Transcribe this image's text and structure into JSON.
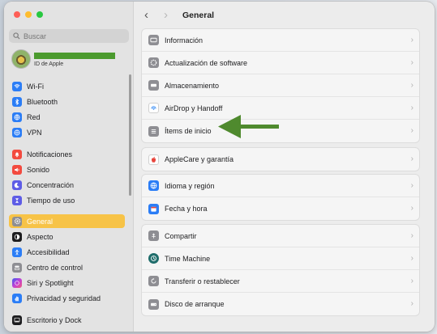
{
  "search": {
    "placeholder": "Buscar"
  },
  "account": {
    "subtitle": "ID de Apple"
  },
  "sidebar": {
    "items": [
      {
        "label": "Wi-Fi",
        "icon": "wifi-icon",
        "color": "#2b7df6"
      },
      {
        "label": "Bluetooth",
        "icon": "bluetooth-icon",
        "color": "#2b7df6"
      },
      {
        "label": "Red",
        "icon": "globe-icon",
        "color": "#2b7df6"
      },
      {
        "label": "VPN",
        "icon": "vpn-globe-icon",
        "color": "#2b7df6"
      },
      {
        "label": "Notificaciones",
        "icon": "bell-icon",
        "color": "#f34a3f"
      },
      {
        "label": "Sonido",
        "icon": "speaker-icon",
        "color": "#f34a3f"
      },
      {
        "label": "Concentración",
        "icon": "moon-icon",
        "color": "#5e5ce6"
      },
      {
        "label": "Tiempo de uso",
        "icon": "hourglass-icon",
        "color": "#5e5ce6"
      },
      {
        "label": "General",
        "icon": "gear-icon",
        "color": "#8e8e93"
      },
      {
        "label": "Aspecto",
        "icon": "appearance-icon",
        "color": "#1c1c1e"
      },
      {
        "label": "Accesibilidad",
        "icon": "accessibility-icon",
        "color": "#2b7df6"
      },
      {
        "label": "Centro de control",
        "icon": "control-center-icon",
        "color": "#8e8e93"
      },
      {
        "label": "Siri y Spotlight",
        "icon": "siri-icon",
        "color": "#b34ad8"
      },
      {
        "label": "Privacidad y seguridad",
        "icon": "hand-icon",
        "color": "#2b7df6"
      },
      {
        "label": "Escritorio y Dock",
        "icon": "dock-icon",
        "color": "#1c1c1e"
      }
    ]
  },
  "header": {
    "title": "General",
    "back": "‹",
    "forward": "›"
  },
  "groups": [
    {
      "rows": [
        {
          "label": "Información",
          "icon": "info-icon",
          "color": "#8e8e93"
        },
        {
          "label": "Actualización de software",
          "icon": "software-update-icon",
          "color": "#8e8e93"
        },
        {
          "label": "Almacenamiento",
          "icon": "storage-icon",
          "color": "#8e8e93"
        },
        {
          "label": "AirDrop y Handoff",
          "icon": "airdrop-icon",
          "color": "#3a8ef5"
        },
        {
          "label": "Ítems de inicio",
          "icon": "login-items-icon",
          "color": "#8e8e93"
        }
      ]
    },
    {
      "rows": [
        {
          "label": "AppleCare y garantía",
          "icon": "apple-icon",
          "color": "#e8453c"
        }
      ]
    },
    {
      "rows": [
        {
          "label": "Idioma y región",
          "icon": "language-globe-icon",
          "color": "#2b7df6"
        },
        {
          "label": "Fecha y hora",
          "icon": "calendar-icon",
          "color": "#2b7df6"
        }
      ]
    },
    {
      "rows": [
        {
          "label": "Compartir",
          "icon": "share-icon",
          "color": "#8e8e93"
        },
        {
          "label": "Time Machine",
          "icon": "time-machine-icon",
          "color": "#1f6d6b"
        },
        {
          "label": "Transferir o restablecer",
          "icon": "reset-icon",
          "color": "#8e8e93"
        },
        {
          "label": "Disco de arranque",
          "icon": "disk-icon",
          "color": "#8e8e93"
        }
      ]
    }
  ],
  "annotation": {
    "color": "#4f8a2e"
  },
  "colors": {
    "selected": "#f7c347"
  }
}
